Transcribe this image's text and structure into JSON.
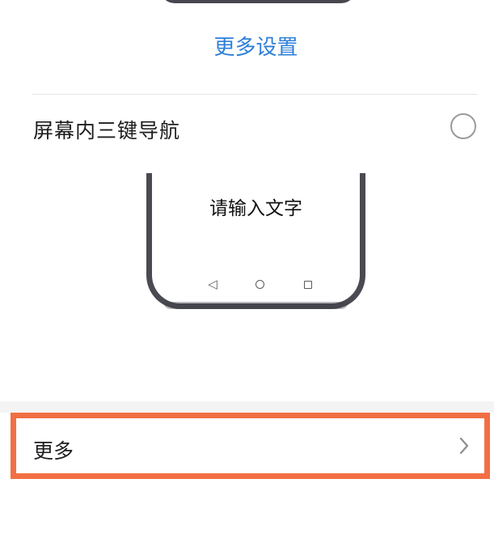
{
  "settings": {
    "more_settings": "更多设置",
    "three_key_nav_label": "屏幕内三键导航",
    "preview_text": "请输入文字",
    "more_label": "更多"
  },
  "icons": {
    "radio": "radio-unselected-icon",
    "back": "back-triangle-icon",
    "home": "home-circle-icon",
    "recent": "recent-square-icon",
    "chevron": "chevron-right-icon"
  },
  "colors": {
    "link": "#2f7fd8",
    "highlight": "#f26f44",
    "phone_frame": "#4a4a52",
    "text": "#1d1d1d"
  }
}
